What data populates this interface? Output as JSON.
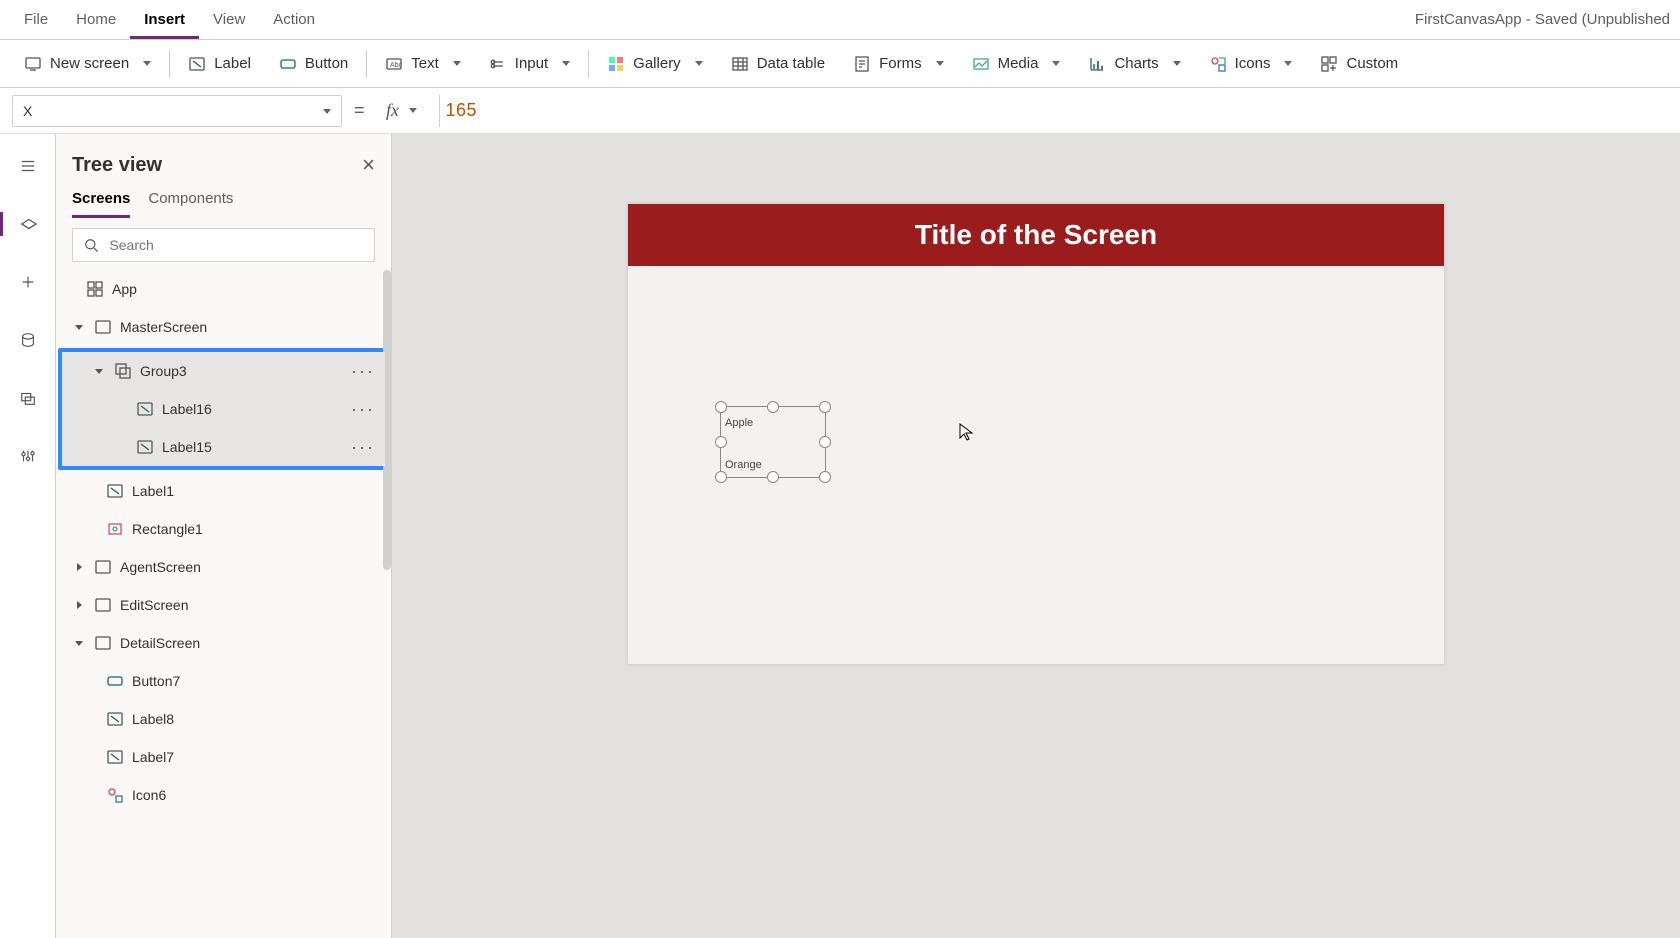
{
  "menubar": {
    "items": [
      "File",
      "Home",
      "Insert",
      "View",
      "Action"
    ],
    "active": "Insert",
    "title": "FirstCanvasApp - Saved (Unpublished"
  },
  "ribbon": {
    "new_screen": "New screen",
    "label": "Label",
    "button": "Button",
    "text": "Text",
    "input": "Input",
    "gallery": "Gallery",
    "data_table": "Data table",
    "forms": "Forms",
    "media": "Media",
    "charts": "Charts",
    "icons": "Icons",
    "custom": "Custom"
  },
  "formula": {
    "property": "X",
    "equals": "=",
    "fx": "fx",
    "value": "165"
  },
  "treepanel": {
    "title": "Tree view",
    "close": "×",
    "tabs": {
      "screens": "Screens",
      "components": "Components"
    },
    "search_placeholder": "Search",
    "items": {
      "app": "App",
      "master": "MasterScreen",
      "group3": "Group3",
      "label16": "Label16",
      "label15": "Label15",
      "label1": "Label1",
      "rectangle1": "Rectangle1",
      "agent": "AgentScreen",
      "edit": "EditScreen",
      "detail": "DetailScreen",
      "button7": "Button7",
      "label8": "Label8",
      "label7": "Label7",
      "icon6": "Icon6"
    },
    "more": "···"
  },
  "canvas": {
    "title": "Title of the Screen",
    "group_labels": [
      "Apple",
      "Orange"
    ]
  }
}
